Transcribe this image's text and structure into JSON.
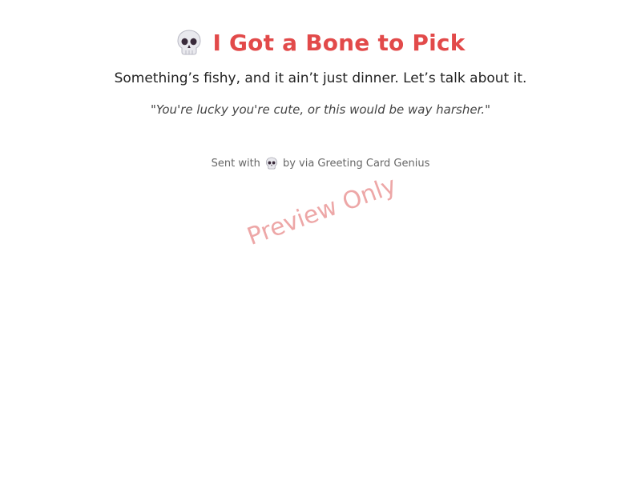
{
  "card": {
    "title": "I Got a Bone to Pick",
    "title_icon": "skull-icon",
    "subtitle": "Something’s fishy, and it ain’t just dinner. Let’s talk about it.",
    "quote": "\"You're lucky you're cute, or this would be way harsher.\"",
    "footer": {
      "prefix": "Sent with",
      "icon": "skull-icon",
      "suffix": "by via Greeting Card Genius"
    }
  },
  "watermark": "Preview Only",
  "colors": {
    "title": "#e24a4a",
    "watermark": "#e88a8a",
    "text": "#222222",
    "muted": "#666666"
  }
}
